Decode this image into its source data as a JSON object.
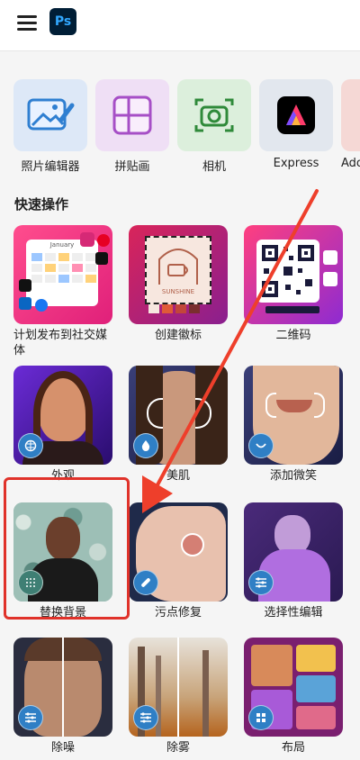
{
  "header": {
    "logo_text": "Ps"
  },
  "apps": [
    {
      "label": "照片编辑器",
      "icon": "photo-editor-icon"
    },
    {
      "label": "拼贴画",
      "icon": "collage-icon"
    },
    {
      "label": "相机",
      "icon": "camera-icon"
    },
    {
      "label": "Express",
      "icon": "adobe-express-icon"
    },
    {
      "label": "Ado",
      "icon": "adobe-app-icon"
    }
  ],
  "section": {
    "title": "快速操作"
  },
  "thumb_text": {
    "calendar_month": "January",
    "logo_text": "SUNSHINE"
  },
  "tools": [
    {
      "label": "计划发布到社交媒体"
    },
    {
      "label": "创建徽标"
    },
    {
      "label": "二维码"
    },
    {
      "label": "外观"
    },
    {
      "label": "美肌"
    },
    {
      "label": "添加微笑"
    },
    {
      "label": "替换背景"
    },
    {
      "label": "污点修复"
    },
    {
      "label": "选择性编辑"
    },
    {
      "label": "除噪"
    },
    {
      "label": "除雾"
    },
    {
      "label": "布局"
    }
  ],
  "colors": {
    "highlight": "#e0322a",
    "arrow": "#ee3f2b",
    "badge": "#2f7fc5"
  }
}
